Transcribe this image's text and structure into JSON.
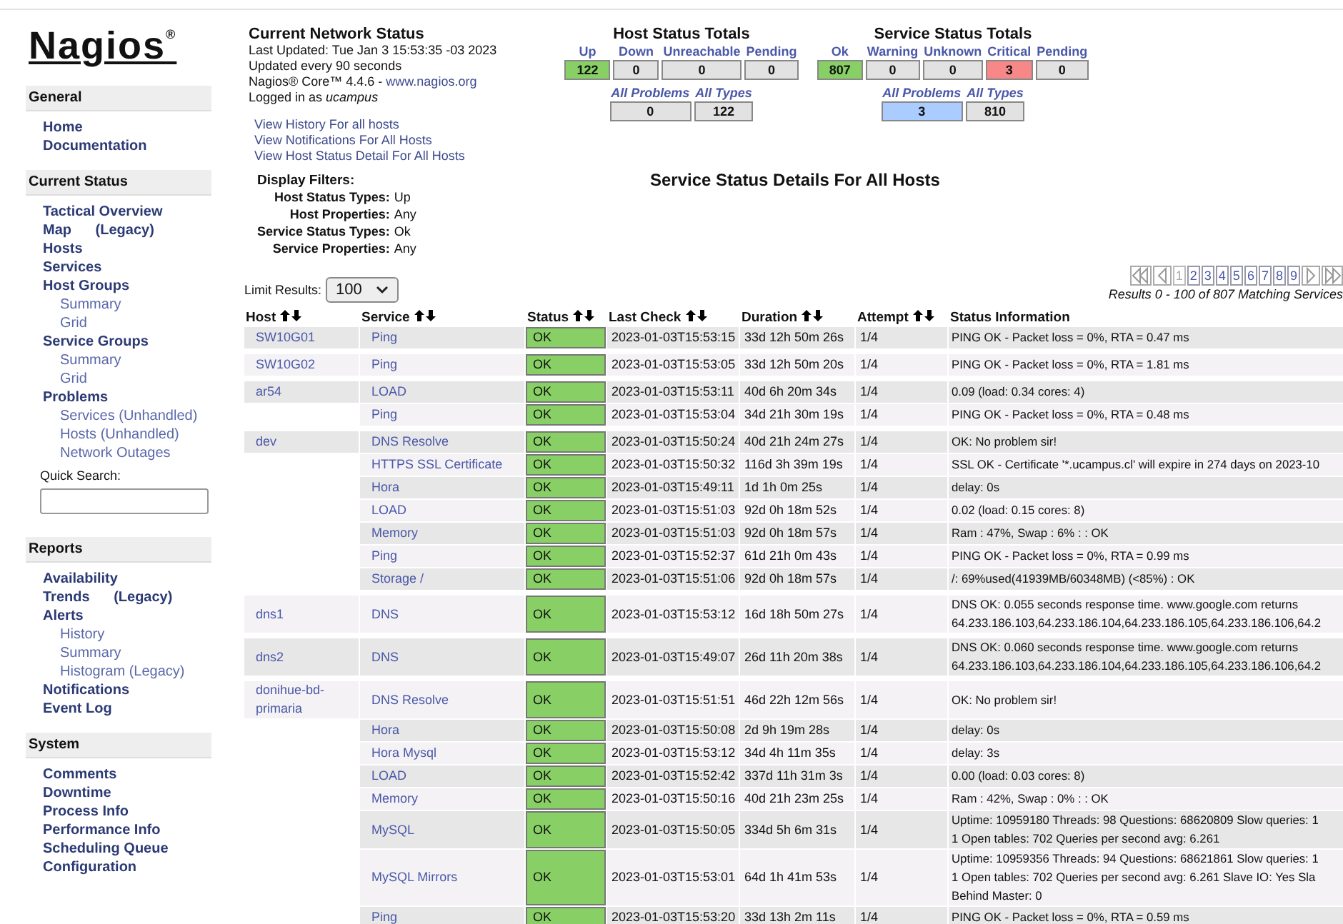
{
  "logo": {
    "text": "Nagios",
    "mark": "®"
  },
  "sidebar": [
    {
      "title": "General",
      "items": [
        {
          "label": "Home"
        },
        {
          "label": "Documentation"
        }
      ]
    },
    {
      "title": "Current Status",
      "items": [
        {
          "label": "Tactical Overview"
        },
        {
          "label": "Map",
          "note": "(Legacy)"
        },
        {
          "label": "Hosts"
        },
        {
          "label": "Services"
        },
        {
          "label": "Host Groups",
          "children": [
            {
              "label": "Summary"
            },
            {
              "label": "Grid"
            }
          ]
        },
        {
          "label": "Service Groups",
          "children": [
            {
              "label": "Summary"
            },
            {
              "label": "Grid"
            }
          ]
        },
        {
          "label": "Problems",
          "children": [
            {
              "label": "Services (Unhandled)"
            },
            {
              "label": "Hosts (Unhandled)"
            },
            {
              "label": "Network Outages"
            }
          ]
        }
      ],
      "search": {
        "label": "Quick Search:"
      }
    },
    {
      "title": "Reports",
      "items": [
        {
          "label": "Availability"
        },
        {
          "label": "Trends",
          "note": "(Legacy)"
        },
        {
          "label": "Alerts",
          "children": [
            {
              "label": "History"
            },
            {
              "label": "Summary"
            },
            {
              "label": "Histogram (Legacy)"
            }
          ]
        },
        {
          "label": "Notifications"
        },
        {
          "label": "Event Log"
        }
      ]
    },
    {
      "title": "System",
      "items": [
        {
          "label": "Comments"
        },
        {
          "label": "Downtime"
        },
        {
          "label": "Process Info"
        },
        {
          "label": "Performance Info"
        },
        {
          "label": "Scheduling Queue"
        },
        {
          "label": "Configuration"
        }
      ]
    }
  ],
  "network_status": {
    "title": "Current Network Status",
    "lines": [
      "Last Updated: Tue Jan 3 15:53:35 -03 2023",
      "Updated every 90 seconds"
    ],
    "version": "Nagios® Core™ 4.4.6 - ",
    "website": "www.nagios.org",
    "login": "Logged in as *ucampus*",
    "links": [
      "View History For all hosts",
      "View Notifications For All Hosts",
      "View Host Status Detail For All Hosts"
    ]
  },
  "host_totals": {
    "title": "Host Status Totals",
    "columns": [
      {
        "label": "Up",
        "value": "122",
        "color": "#88d066"
      },
      {
        "label": "Down",
        "value": "0",
        "color": "#e2e2e2"
      },
      {
        "label": "Unreachable",
        "value": "0",
        "color": "#e2e2e2"
      },
      {
        "label": "Pending",
        "value": "0",
        "color": "#e2e2e2"
      }
    ],
    "summary": [
      {
        "label": "All Problems",
        "value": "0",
        "color": "#e2e2e2"
      },
      {
        "label": "All Types",
        "value": "122",
        "color": "#e2e2e2"
      }
    ]
  },
  "service_totals": {
    "title": "Service Status Totals",
    "columns": [
      {
        "label": "Ok",
        "value": "807",
        "color": "#88d066"
      },
      {
        "label": "Warning",
        "value": "0",
        "color": "#e2e2e2"
      },
      {
        "label": "Unknown",
        "value": "0",
        "color": "#e2e2e2"
      },
      {
        "label": "Critical",
        "value": "3",
        "color": "#f88888"
      },
      {
        "label": "Pending",
        "value": "0",
        "color": "#e2e2e2"
      }
    ],
    "summary": [
      {
        "label": "All Problems",
        "value": "3",
        "color": "#aaccff"
      },
      {
        "label": "All Types",
        "value": "810",
        "color": "#e2e2e2"
      }
    ]
  },
  "filters": {
    "title": "Display Filters:",
    "items": [
      {
        "label": "Host Status Types:",
        "value": "Up"
      },
      {
        "label": "Host Properties:",
        "value": "Any"
      },
      {
        "label": "Service Status Types:",
        "value": "Ok"
      },
      {
        "label": "Service Properties:",
        "value": "Any"
      }
    ]
  },
  "page_title": "Service Status Details For All Hosts",
  "limit": {
    "label": "Limit Results:",
    "value": "100"
  },
  "pagination": {
    "pages": [
      {
        "label": "1",
        "selected": true
      },
      {
        "label": "2",
        "selected": false
      },
      {
        "label": "3",
        "selected": false
      },
      {
        "label": "4",
        "selected": false
      },
      {
        "label": "5",
        "selected": false
      },
      {
        "label": "6",
        "selected": false
      },
      {
        "label": "7",
        "selected": false
      },
      {
        "label": "8",
        "selected": false
      },
      {
        "label": "9",
        "selected": false
      }
    ],
    "results": "Results 0 - 100 of 807 Matching Services"
  },
  "table": {
    "columns": [
      {
        "label": "Host",
        "sortable": true
      },
      {
        "label": "Service",
        "sortable": true
      },
      {
        "label": "Status",
        "sortable": true
      },
      {
        "label": "Last Check",
        "sortable": true
      },
      {
        "label": "Duration",
        "sortable": true
      },
      {
        "label": "Attempt",
        "sortable": true
      },
      {
        "label": "Status Information",
        "sortable": false
      }
    ],
    "hosts": [
      {
        "host": "SW10G01",
        "services": [
          {
            "service": "Ping",
            "status": "OK",
            "last_check": "2023-01-03T15:53:15",
            "duration": "33d 12h 50m 26s",
            "attempt": "1/4",
            "info": [
              "PING OK - Packet loss = 0%, RTA = 0.47 ms"
            ]
          }
        ]
      },
      {
        "host": "SW10G02",
        "services": [
          {
            "service": "Ping",
            "status": "OK",
            "last_check": "2023-01-03T15:53:05",
            "duration": "33d 12h 50m 20s",
            "attempt": "1/4",
            "info": [
              "PING OK - Packet loss = 0%, RTA = 1.81 ms"
            ]
          }
        ]
      },
      {
        "host": "ar54",
        "services": [
          {
            "service": "LOAD",
            "status": "OK",
            "last_check": "2023-01-03T15:53:11",
            "duration": "40d 6h 20m 34s",
            "attempt": "1/4",
            "info": [
              "0.09 (load: 0.34 cores: 4)"
            ]
          },
          {
            "service": "Ping",
            "status": "OK",
            "last_check": "2023-01-03T15:53:04",
            "duration": "34d 21h 30m 19s",
            "attempt": "1/4",
            "info": [
              "PING OK - Packet loss = 0%, RTA = 0.48 ms"
            ]
          }
        ]
      },
      {
        "host": "dev",
        "services": [
          {
            "service": "DNS Resolve",
            "status": "OK",
            "last_check": "2023-01-03T15:50:24",
            "duration": "40d 21h 24m 27s",
            "attempt": "1/4",
            "info": [
              "OK: No problem sir!"
            ]
          },
          {
            "service": "HTTPS SSL Certificate",
            "status": "OK",
            "last_check": "2023-01-03T15:50:32",
            "duration": "116d 3h 39m 19s",
            "attempt": "1/4",
            "info": [
              "SSL OK - Certificate '*.ucampus.cl' will expire in 274 days on 2023-10"
            ]
          },
          {
            "service": "Hora",
            "status": "OK",
            "last_check": "2023-01-03T15:49:11",
            "duration": "1d 1h 0m 25s",
            "attempt": "1/4",
            "info": [
              "delay: 0s"
            ]
          },
          {
            "service": "LOAD",
            "status": "OK",
            "last_check": "2023-01-03T15:51:03",
            "duration": "92d 0h 18m 52s",
            "attempt": "1/4",
            "info": [
              "0.02 (load: 0.15 cores: 8)"
            ]
          },
          {
            "service": "Memory",
            "status": "OK",
            "last_check": "2023-01-03T15:51:03",
            "duration": "92d 0h 18m 57s",
            "attempt": "1/4",
            "info": [
              "Ram : 47%, Swap : 6% : : OK"
            ]
          },
          {
            "service": "Ping",
            "status": "OK",
            "last_check": "2023-01-03T15:52:37",
            "duration": "61d 21h 0m 43s",
            "attempt": "1/4",
            "info": [
              "PING OK - Packet loss = 0%, RTA = 0.99 ms"
            ]
          },
          {
            "service": "Storage /",
            "status": "OK",
            "last_check": "2023-01-03T15:51:06",
            "duration": "92d 0h 18m 57s",
            "attempt": "1/4",
            "info": [
              "/: 69%used(41939MB/60348MB) (<85%) : OK"
            ]
          }
        ]
      },
      {
        "host": "dns1",
        "services": [
          {
            "service": "DNS",
            "status": "OK",
            "last_check": "2023-01-03T15:53:12",
            "duration": "16d 18h 50m 27s",
            "attempt": "1/4",
            "info": [
              "DNS OK: 0.055 seconds response time. www.google.com returns",
              "64.233.186.103,64.233.186.104,64.233.186.105,64.233.186.106,64.2"
            ]
          }
        ]
      },
      {
        "host": "dns2",
        "services": [
          {
            "service": "DNS",
            "status": "OK",
            "last_check": "2023-01-03T15:49:07",
            "duration": "26d 11h 20m 38s",
            "attempt": "1/4",
            "info": [
              "DNS OK: 0.060 seconds response time. www.google.com returns",
              "64.233.186.103,64.233.186.104,64.233.186.105,64.233.186.106,64.2"
            ]
          }
        ]
      },
      {
        "host": "donihue-bd-primaria",
        "services": [
          {
            "service": "DNS Resolve",
            "status": "OK",
            "last_check": "2023-01-03T15:51:51",
            "duration": "46d 22h 12m 56s",
            "attempt": "1/4",
            "info": [
              "OK: No problem sir!"
            ]
          },
          {
            "service": "Hora",
            "status": "OK",
            "last_check": "2023-01-03T15:50:08",
            "duration": "2d 9h 19m 28s",
            "attempt": "1/4",
            "info": [
              "delay: 0s"
            ]
          },
          {
            "service": "Hora Mysql",
            "status": "OK",
            "last_check": "2023-01-03T15:53:12",
            "duration": "34d 4h 11m 35s",
            "attempt": "1/4",
            "info": [
              "delay: 3s"
            ]
          },
          {
            "service": "LOAD",
            "status": "OK",
            "last_check": "2023-01-03T15:52:42",
            "duration": "337d 11h 31m 3s",
            "attempt": "1/4",
            "info": [
              "0.00 (load: 0.03 cores: 8)"
            ]
          },
          {
            "service": "Memory",
            "status": "OK",
            "last_check": "2023-01-03T15:50:16",
            "duration": "40d 21h 23m 25s",
            "attempt": "1/4",
            "info": [
              "Ram : 42%, Swap : 0% : : OK"
            ]
          },
          {
            "service": "MySQL",
            "status": "OK",
            "last_check": "2023-01-03T15:50:05",
            "duration": "334d 5h 6m 31s",
            "attempt": "1/4",
            "info": [
              "Uptime: 10959180 Threads: 98 Questions: 68620809 Slow queries: 1",
              "1 Open tables: 702 Queries per second avg: 6.261"
            ]
          },
          {
            "service": "MySQL Mirrors",
            "status": "OK",
            "last_check": "2023-01-03T15:53:01",
            "duration": "64d 1h 41m 53s",
            "attempt": "1/4",
            "info": [
              "Uptime: 10959356 Threads: 94 Questions: 68621861 Slow queries: 1",
              "1 Open tables: 702 Queries per second avg: 6.261 Slave IO: Yes Sla",
              "Behind Master: 0"
            ]
          },
          {
            "service": "Ping",
            "status": "OK",
            "last_check": "2023-01-03T15:53:20",
            "duration": "33d 13h 2m 11s",
            "attempt": "1/4",
            "info": [
              "PING OK - Packet loss = 0%, RTA = 0.59 ms"
            ]
          }
        ]
      }
    ]
  }
}
